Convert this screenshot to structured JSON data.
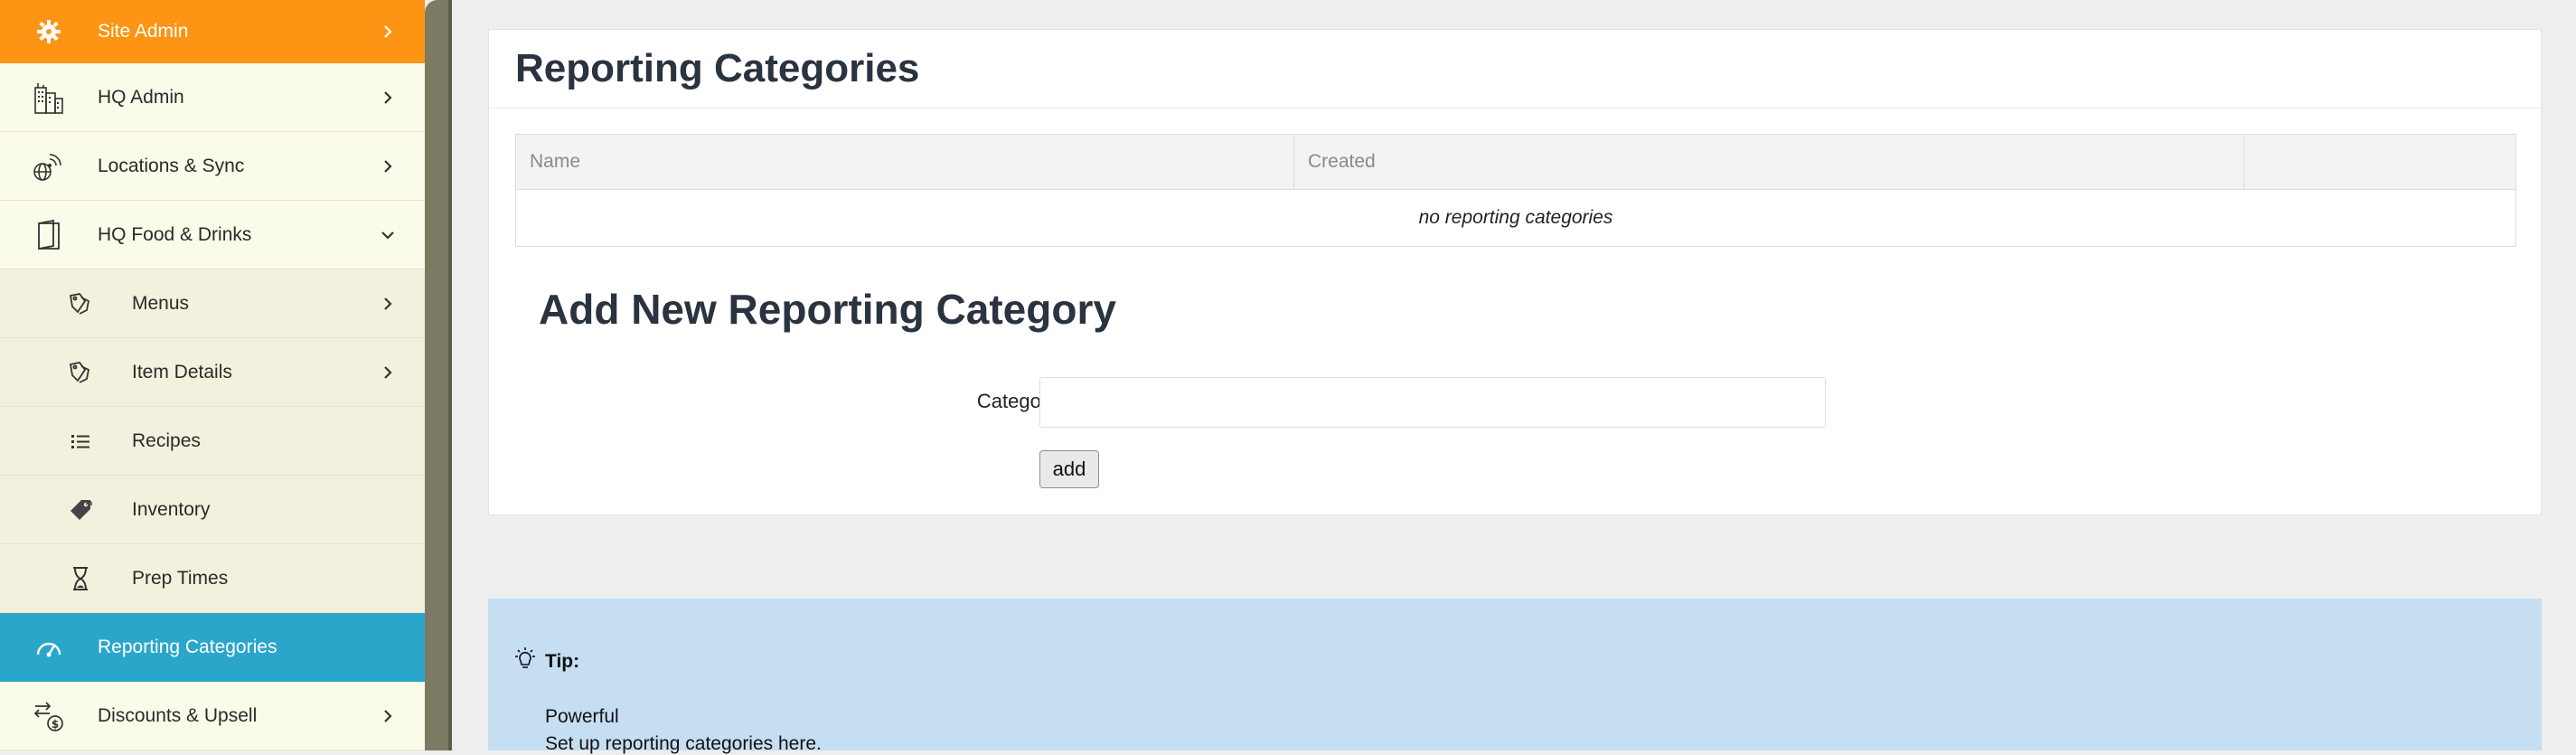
{
  "sidebar": {
    "items": [
      {
        "label": "Site Admin",
        "icon": "gear-badge-icon",
        "style": "orange",
        "chevron": "right"
      },
      {
        "label": "HQ Admin",
        "icon": "building-icon",
        "chevron": "right"
      },
      {
        "label": "Locations & Sync",
        "icon": "globe-signal-icon",
        "chevron": "right"
      },
      {
        "label": "HQ Food & Drinks",
        "icon": "book-icon",
        "chevron": "down"
      },
      {
        "label": "Menus",
        "icon": "tags-icon",
        "chevron": "right"
      },
      {
        "label": "Item Details",
        "icon": "tags-icon",
        "chevron": "right"
      },
      {
        "label": "Recipes",
        "icon": "list-icon"
      },
      {
        "label": "Inventory",
        "icon": "tag-icon"
      },
      {
        "label": "Prep Times",
        "icon": "hourglass-icon"
      },
      {
        "label": "Reporting Categories",
        "icon": "dashboard-icon",
        "style": "active"
      },
      {
        "label": "Discounts & Upsell",
        "icon": "exchange-dollar-icon",
        "chevron": "right"
      }
    ],
    "colors": {
      "orange": "#fd9413",
      "active": "#2ba6cb",
      "background": "#fbfaea"
    }
  },
  "main": {
    "title": "Reporting Categories",
    "table": {
      "columns": [
        "Name",
        "Created",
        ""
      ],
      "empty_message": "no reporting categories"
    },
    "form": {
      "title": "Add New Reporting Category",
      "category_name_label": "Category Name",
      "category_name_value": "",
      "category_name_placeholder": "",
      "add_button": "add"
    }
  },
  "tip": {
    "icon": "lightbulb-icon",
    "title": "Tip:",
    "lines": [
      "Powerful",
      "Set up reporting categories here."
    ],
    "background": "#c5def2"
  }
}
